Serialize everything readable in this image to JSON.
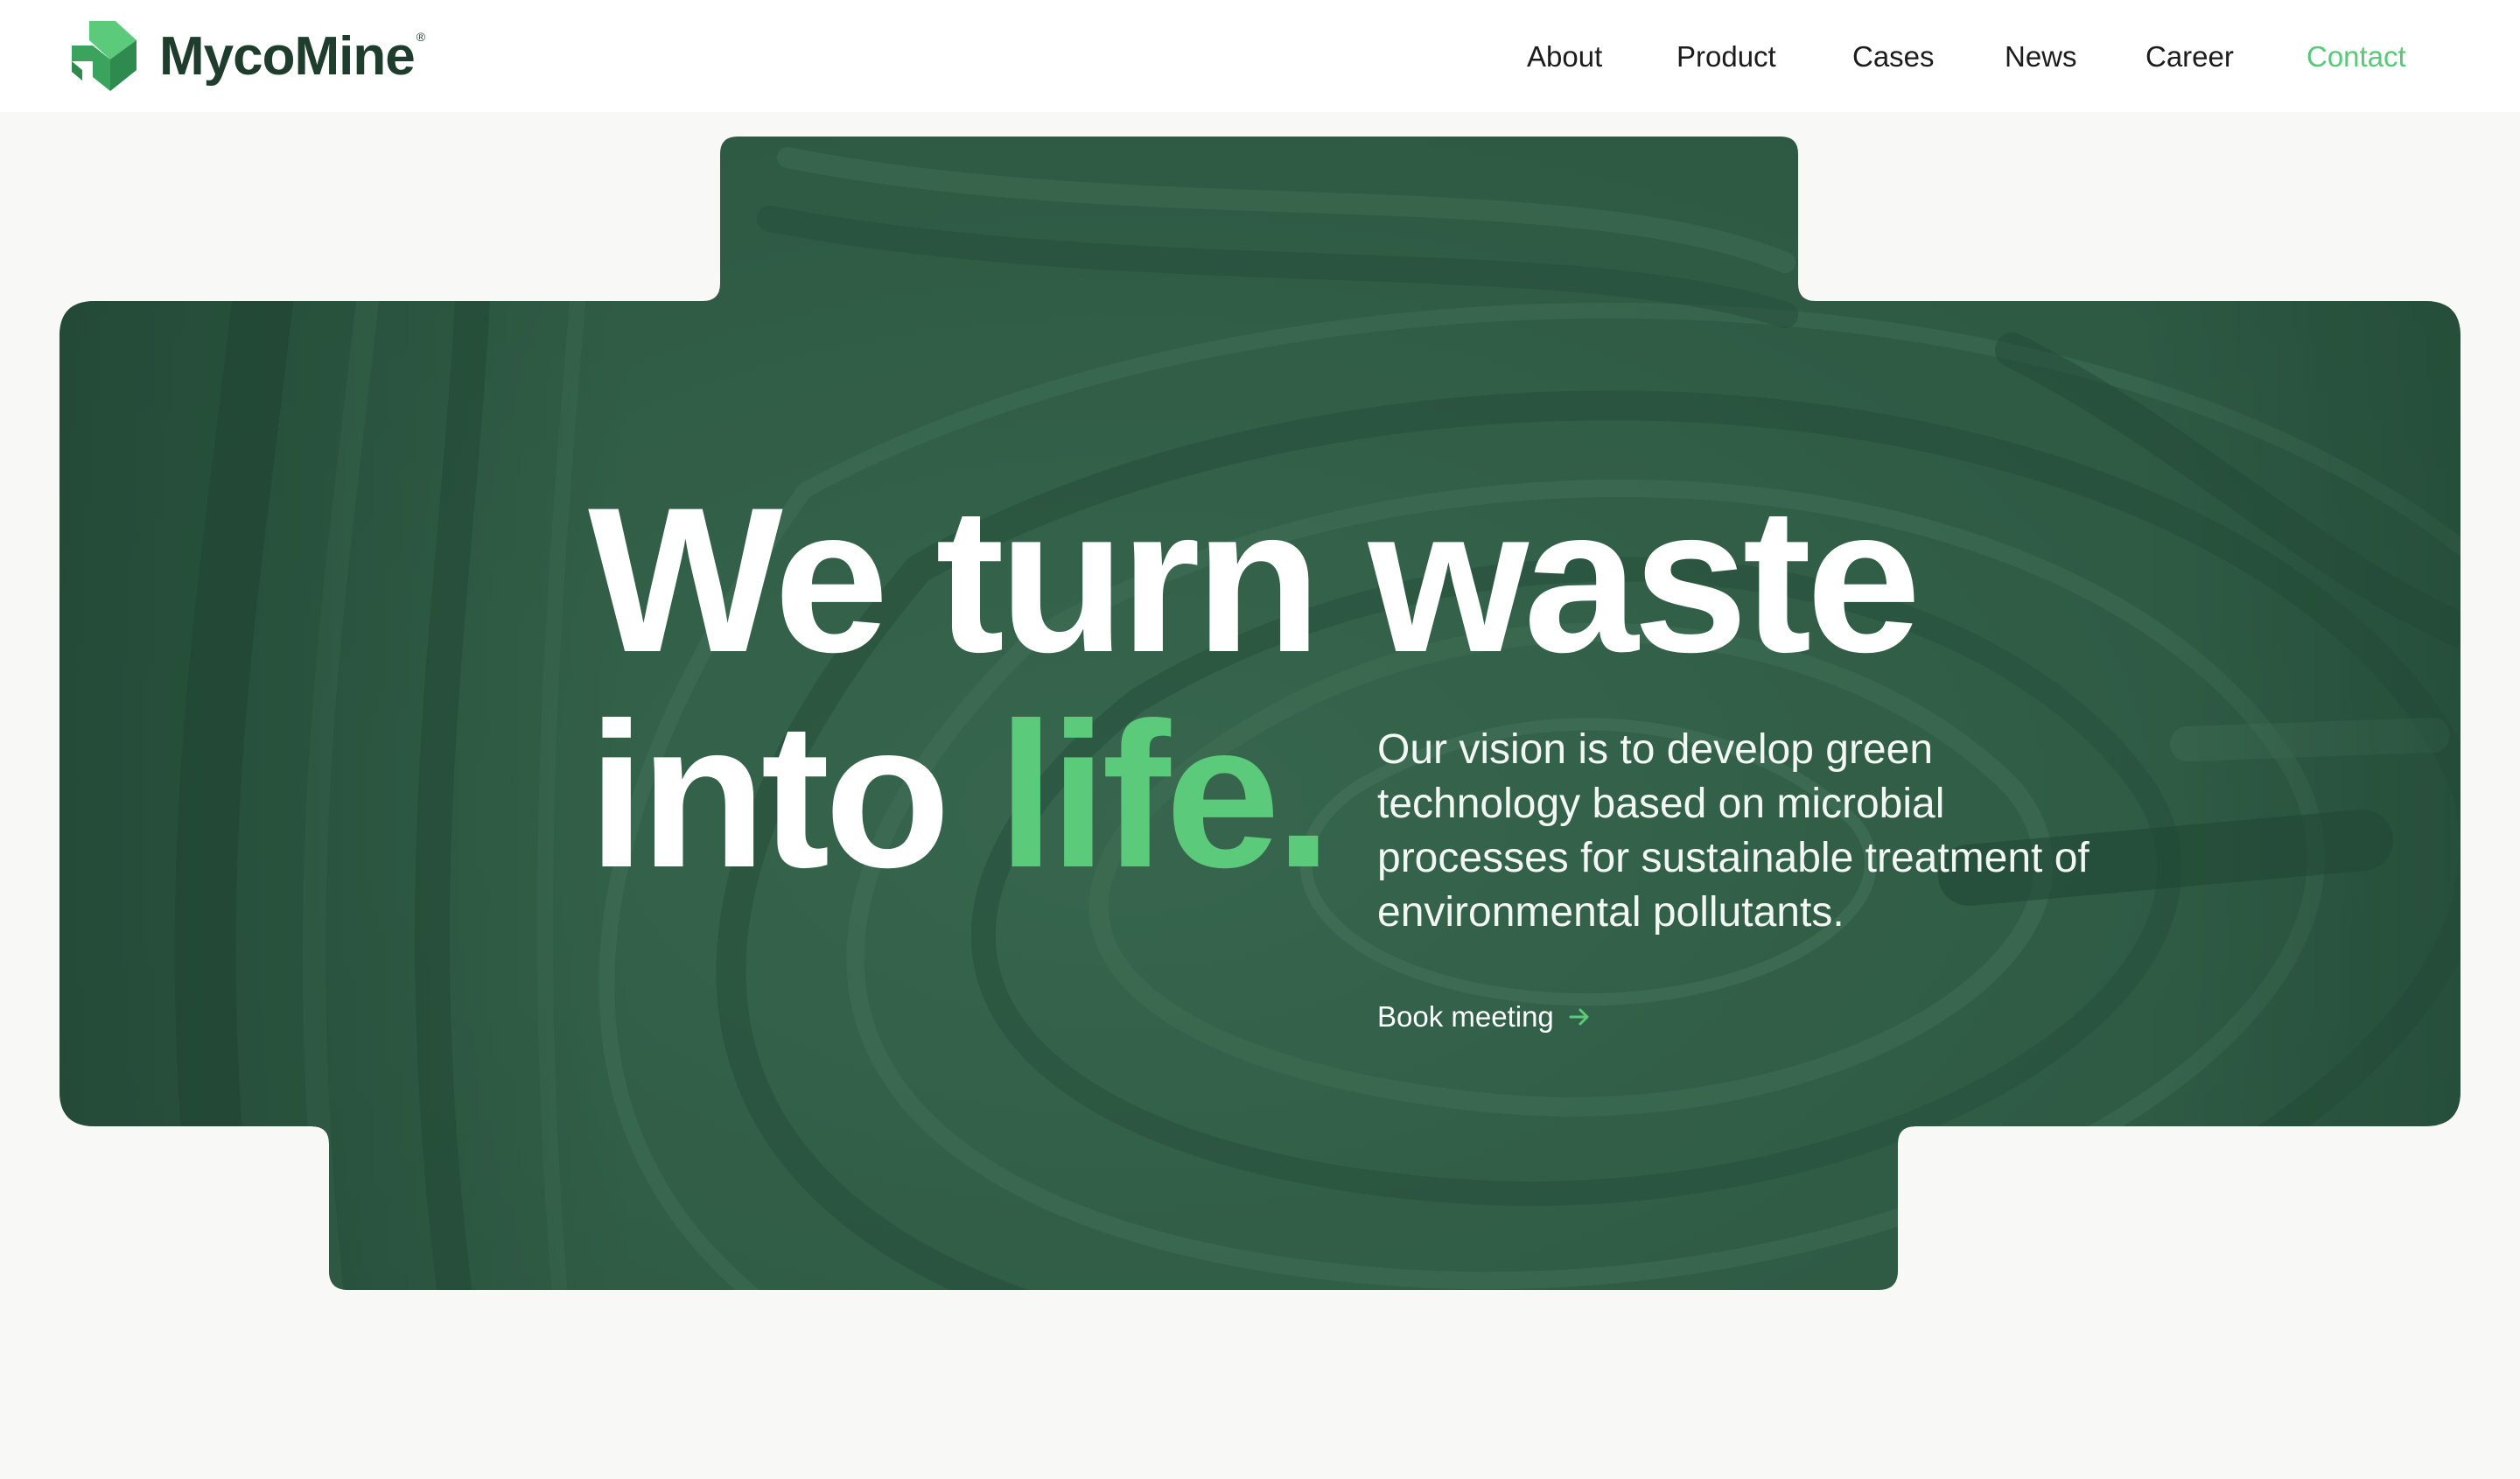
{
  "brand": {
    "name": "MycoMine",
    "reg": "®",
    "logo_icon": "stacked-arrows-logo-icon",
    "accent_color": "#59c878",
    "dark_color": "#1f3d2c"
  },
  "nav": {
    "items": [
      {
        "label": "About"
      },
      {
        "label": "Product"
      },
      {
        "label": "Cases"
      },
      {
        "label": "News"
      },
      {
        "label": "Career"
      },
      {
        "label": "Contact",
        "active": true
      }
    ]
  },
  "hero": {
    "headline_line1": "We turn waste",
    "headline_line2_plain": "into ",
    "headline_line2_accent": "life.",
    "vision_text": "Our vision is to develop green technology based on microbial processes for sustainable treatment of environmental pollutants.",
    "cta_label": "Book meeting",
    "cta_icon": "arrow-right-icon",
    "background_color": "#2f5c45",
    "accent_color": "#5cca7b"
  }
}
